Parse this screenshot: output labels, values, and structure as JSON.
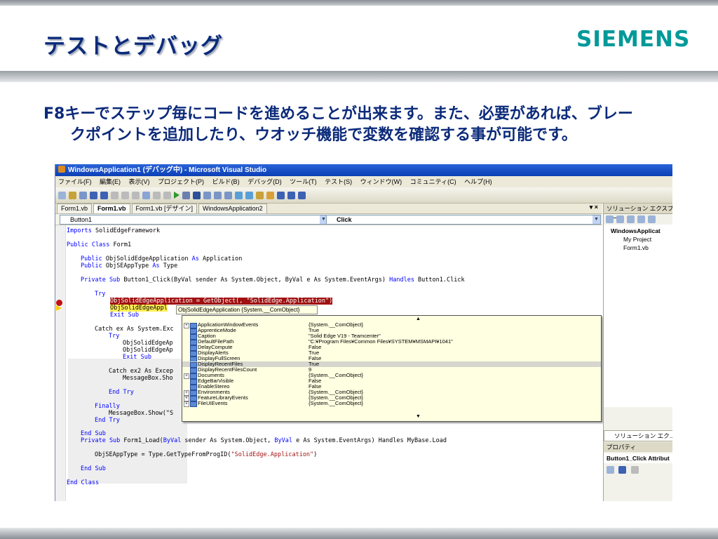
{
  "slide": {
    "title": "テストとデバッグ",
    "logo": "SIEMENS",
    "body_line1": "F8キーでステップ毎にコードを進めることが出来ます。また、必要があれば、ブレー",
    "body_line2": "クポイントを追加したり、ウオッチ機能で変数を確認する事が可能です。"
  },
  "window": {
    "title": "WindowsApplication1 (デバッグ中) - Microsoft Visual Studio",
    "menu": [
      "ファイル(F)",
      "編集(E)",
      "表示(V)",
      "プロジェクト(P)",
      "ビルド(B)",
      "デバッグ(D)",
      "ツール(T)",
      "テスト(S)",
      "ウィンドウ(W)",
      "コミュニティ(C)",
      "ヘルプ(H)"
    ],
    "tabs": [
      "Form1.vb",
      "Form1.vb",
      "Form1.vb [デザイン]",
      "WindowsApplication2"
    ],
    "tab_close": "▾ ×",
    "object_dropdown": "Button1",
    "event_dropdown": "Click"
  },
  "code": {
    "l1_kw": "Imports",
    "l1_rest": " SolidEdgeFramework",
    "l2_kw": "Public Class",
    "l2_rest": " Form1",
    "l3_kw": "Public",
    "l3_rest": " ObjSolidEdgeApplication ",
    "l3_kw2": "As",
    "l3_rest2": " Application",
    "l4_kw": "Public",
    "l4_rest": " ObjSEAppType ",
    "l4_kw2": "As",
    "l4_rest2": " Type",
    "l5_kw": "Private Sub",
    "l5_rest": " Button1_Click(ByVal sender As System.Object, ByVal e As System.EventArgs) ",
    "l5_kw2": "Handles",
    "l5_rest2": " Button1.Click",
    "l6": "Try",
    "l7": "ObjSolidEdgeApplication = GetObject(, \"SolidEdge.Application\")",
    "l8": "ObjSolidEdgeAppl",
    "l9": "Exit Sub",
    "l10": "Catch ex As System.Exc",
    "l11": "Try",
    "l12": "ObjSolidEdgeAp",
    "l13": "ObjSolidEdgeAp",
    "l14": "Exit Sub",
    "l15": "Catch ex2 As Excep",
    "l16": "MessageBox.Sho",
    "l17": "End Try",
    "l18": "Finally",
    "l19": "MessageBox.Show(\"S",
    "l20": "End Try",
    "l21": "End Sub",
    "l22_kw": "Private Sub",
    "l22_rest": " Form1_Load(",
    "l22_kw2": "ByVal",
    "l22_rest2": " sender As System.Object, ",
    "l22_kw3": "ByVal",
    "l22_rest3": " e As System.EventArgs) Handles MyBase.Load",
    "l23_pre": "ObjSEAppType = Type.GetTypeFromProgID(",
    "l23_str": "\"SolidEdge.Application\"",
    "l23_post": ")",
    "l24": "End Sub",
    "l25": "End Class"
  },
  "datatip": {
    "header": "ObjSolidEdgeApplication {System.__ComObject}",
    "rows": [
      {
        "name": "ApplicationWindowEvents",
        "value": "{System.__ComObject}"
      },
      {
        "name": "ApprenticeMode",
        "value": "True"
      },
      {
        "name": "Caption",
        "value": "\"Solid Edge V19 - Teamcenter\""
      },
      {
        "name": "DefaultFilePath",
        "value": "\"C:¥Program Files¥Common Files¥SYSTEM¥MSMAPI¥1041\""
      },
      {
        "name": "DelayCompute",
        "value": "False"
      },
      {
        "name": "DisplayAlerts",
        "value": "True"
      },
      {
        "name": "DisplayFullScreen",
        "value": "False"
      },
      {
        "name": "DisplayRecentFiles",
        "value": "True"
      },
      {
        "name": "DisplayRecentFilesCount",
        "value": "9"
      },
      {
        "name": "Documents",
        "value": "{System.__ComObject}"
      },
      {
        "name": "EdgeBarVisible",
        "value": "False"
      },
      {
        "name": "EnableStereo",
        "value": "False"
      },
      {
        "name": "Environments",
        "value": "{System.__ComObject}"
      },
      {
        "name": "FeatureLibraryEvents",
        "value": "{System.__ComObject}"
      },
      {
        "name": "FileUIEvents",
        "value": "{System.__ComObject}"
      }
    ]
  },
  "right_panel": {
    "title": "ソリューション エクスプローラ",
    "tree_root": "WindowsApplicat",
    "tree_item1": "My Project",
    "tree_item2": "Form1.vb",
    "tab": "ソリューション エク...",
    "props_title": "プロパティ",
    "props_object": "Button1_Click Attribut"
  }
}
